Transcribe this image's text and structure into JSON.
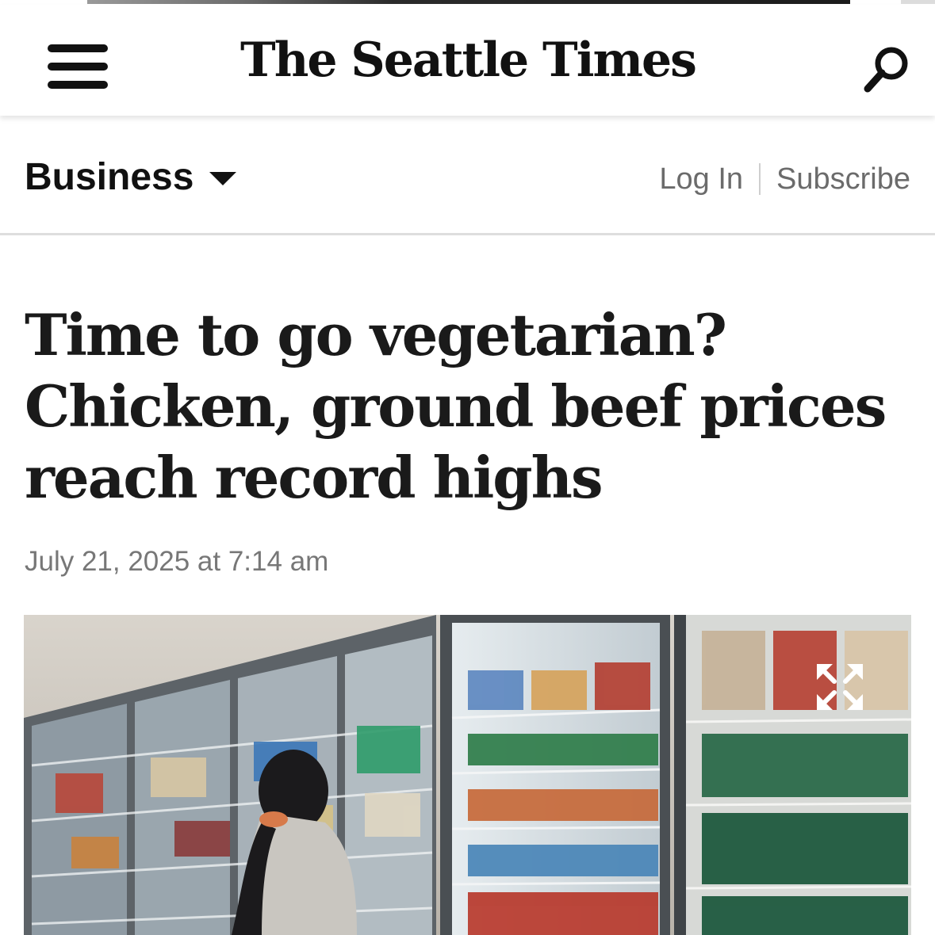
{
  "masthead": {
    "menu_icon": "hamburger-menu-icon",
    "logo_text": "The Seattle Times",
    "search_icon": "search-icon"
  },
  "section_bar": {
    "section_label": "Business",
    "login_label": "Log In",
    "subscribe_label": "Subscribe"
  },
  "article": {
    "headline": "Time to go vegetarian? Chicken, ground beef prices reach record highs",
    "dateline": "July 21, 2025 at 7:14 am"
  },
  "photo": {
    "expand_icon": "expand-icon"
  },
  "colors": {
    "text_primary": "#1a1a1a",
    "text_muted": "#6b6b6b",
    "divider": "#dedede"
  }
}
